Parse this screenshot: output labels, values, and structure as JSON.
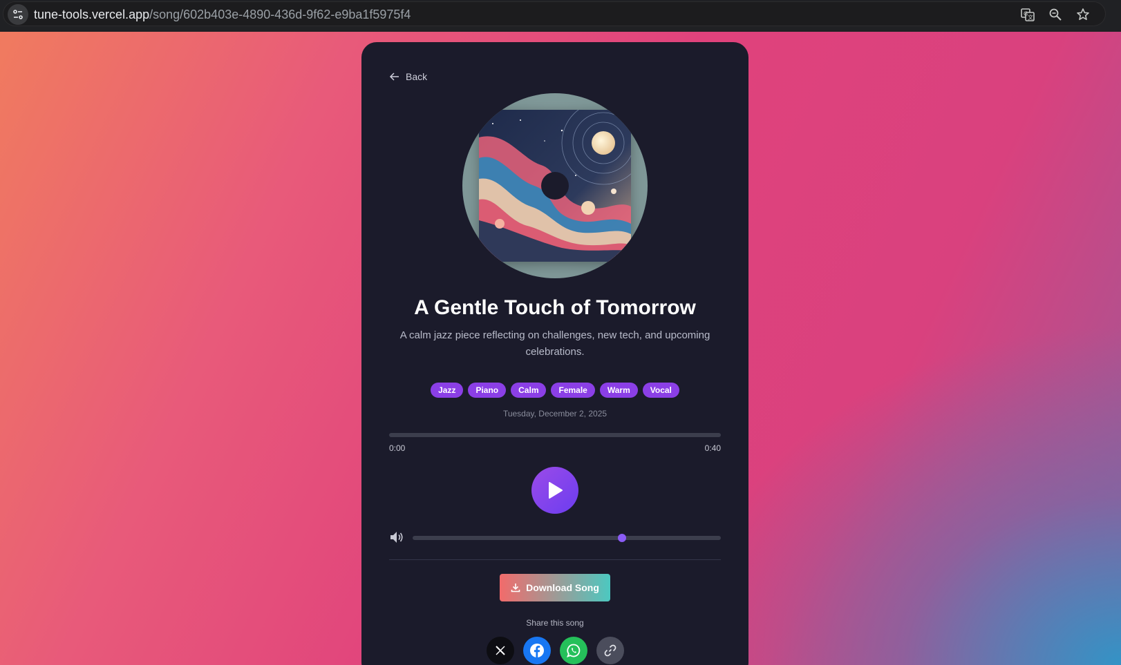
{
  "browser": {
    "url_host": "tune-tools.vercel.app",
    "url_path": "/song/602b403e-4890-436d-9f62-e9ba1f5975f4",
    "icons": [
      "site-info-icon",
      "translate-icon",
      "zoom-icon",
      "bookmark-star-icon"
    ]
  },
  "song": {
    "back_label": "Back",
    "title": "A Gentle Touch of Tomorrow",
    "description": "A calm jazz piece reflecting on challenges, new tech, and upcoming celebrations.",
    "tags": [
      "Jazz",
      "Piano",
      "Calm",
      "Female",
      "Warm",
      "Vocal"
    ],
    "date": "Tuesday, December 2, 2025"
  },
  "player": {
    "current_time": "0:00",
    "duration": "0:40",
    "progress_fraction": 0,
    "volume_fraction": 0.68
  },
  "actions": {
    "download_label": "Download Song",
    "share_label": "Share this song",
    "share_targets": [
      "x-icon",
      "facebook-icon",
      "whatsapp-icon",
      "copy-link-icon"
    ]
  },
  "colors": {
    "accent": "#8b3fe6",
    "card": "#1b1b2b",
    "facebook": "#1877f2",
    "whatsapp": "#25c05a"
  }
}
